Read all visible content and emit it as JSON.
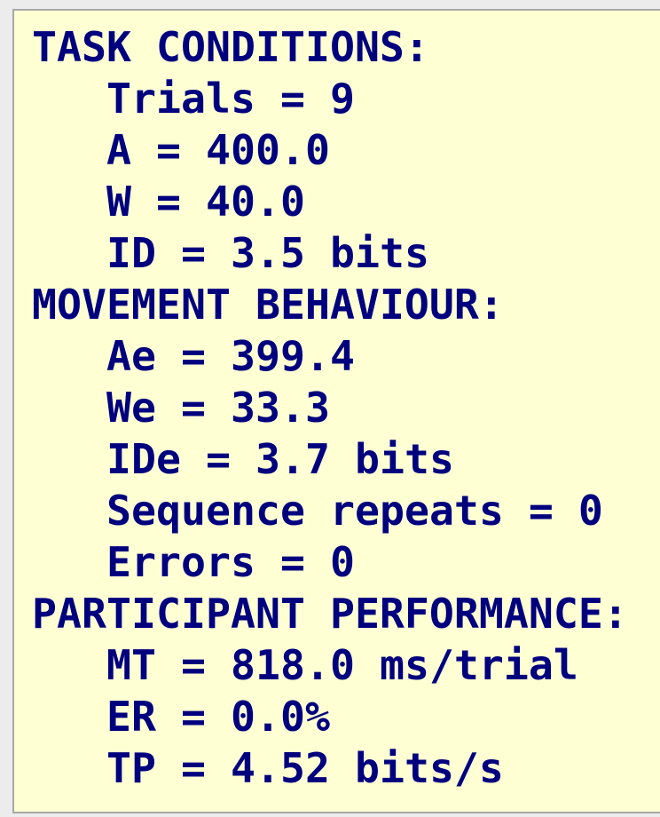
{
  "sections": [
    {
      "heading": "TASK CONDITIONS:",
      "lines": [
        "Trials = 9",
        "A = 400.0",
        "W = 40.0",
        "ID = 3.5 bits"
      ]
    },
    {
      "heading": "MOVEMENT BEHAVIOUR:",
      "lines": [
        "Ae = 399.4",
        "We = 33.3",
        "IDe = 3.7 bits",
        "Sequence repeats = 0",
        "Errors = 0"
      ]
    },
    {
      "heading": "PARTICIPANT PERFORMANCE:",
      "lines": [
        "MT = 818.0 ms/trial",
        "ER = 0.0%",
        "TP = 4.52 bits/s"
      ]
    }
  ],
  "colors": {
    "text": "#00007f",
    "panel_background": "#ffffd4",
    "panel_border": "#a8a8a8",
    "page_background": "#ececec"
  }
}
